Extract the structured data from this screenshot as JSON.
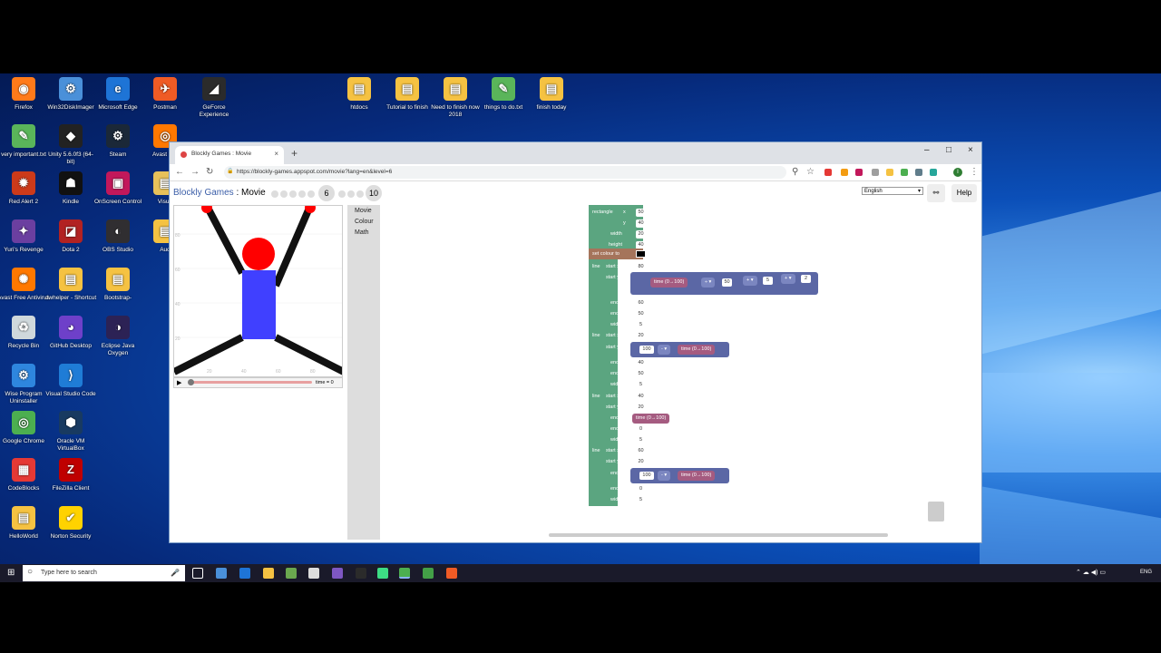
{
  "desktop": {
    "icons": [
      {
        "label": "Firefox",
        "color": "#ff7a1a",
        "glyph": "◉"
      },
      {
        "label": "Win32DiskImager",
        "color": "#4a90d9",
        "glyph": "⚙"
      },
      {
        "label": "Microsoft Edge",
        "color": "#1e74d6",
        "glyph": "e"
      },
      {
        "label": "Postman",
        "color": "#ef5b25",
        "glyph": "✈"
      },
      {
        "label": "GeForce Experience",
        "color": "#2b2b2b",
        "glyph": "◢"
      },
      {
        "label": "very important.txt",
        "color": "#5ab55a",
        "glyph": "✎"
      },
      {
        "label": "Unity 5.6.0f3 (64-bit)",
        "color": "#222222",
        "glyph": "◆"
      },
      {
        "label": "Steam",
        "color": "#1b2838",
        "glyph": "⚙"
      },
      {
        "label": "Avast Bro",
        "color": "#ff7800",
        "glyph": "◎"
      },
      {
        "label": "Red Alert 2",
        "color": "#cc3a1a",
        "glyph": "✹"
      },
      {
        "label": "Kindle",
        "color": "#111111",
        "glyph": "☗"
      },
      {
        "label": "OnScreen Control",
        "color": "#c2185b",
        "glyph": "▣"
      },
      {
        "label": "Visua",
        "color": "#e7c15a",
        "glyph": "▤"
      },
      {
        "label": "Yuri's Revenge",
        "color": "#6b3fa0",
        "glyph": "✦"
      },
      {
        "label": "Dota 2",
        "color": "#b22222",
        "glyph": "◪"
      },
      {
        "label": "OBS Studio",
        "color": "#302e31",
        "glyph": "◐"
      },
      {
        "label": "Aud",
        "color": "#f5c242",
        "glyph": "▤"
      },
      {
        "label": "Avast Free Antivirus",
        "color": "#ff7800",
        "glyph": "✺"
      },
      {
        "label": "dwhelper - Shortcut",
        "color": "#f5c242",
        "glyph": "▤"
      },
      {
        "label": "Bootstrap-",
        "color": "#f5c242",
        "glyph": "▤"
      },
      {
        "label": "Recycle Bin",
        "color": "#cfd8dc",
        "glyph": "♻"
      },
      {
        "label": "GitHub Desktop",
        "color": "#6e40c9",
        "glyph": "◕"
      },
      {
        "label": "Eclipse Java Oxygen",
        "color": "#2c2255",
        "glyph": "◑"
      },
      {
        "label": "Wise Program Uninstaller",
        "color": "#2e86de",
        "glyph": "⚙"
      },
      {
        "label": "Visual Studio Code",
        "color": "#1f7cd6",
        "glyph": "⟩"
      },
      {
        "label": "Google Chrome",
        "color": "#4caf50",
        "glyph": "◎"
      },
      {
        "label": "Oracle VM VirtualBox",
        "color": "#183a61",
        "glyph": "⬢"
      },
      {
        "label": "CodeBlocks",
        "color": "#e53935",
        "glyph": "▦"
      },
      {
        "label": "FileZilla Client",
        "color": "#bf0000",
        "glyph": "Z"
      },
      {
        "label": "HelloWorld",
        "color": "#f5c242",
        "glyph": "▤"
      },
      {
        "label": "Norton Security",
        "color": "#ffd200",
        "glyph": "✔"
      },
      {
        "label": "htdocs",
        "color": "#f5c242",
        "glyph": "▤"
      },
      {
        "label": "Tutorial to finish",
        "color": "#f5c242",
        "glyph": "▤"
      },
      {
        "label": "Need to finish now 2018",
        "color": "#f5c242",
        "glyph": "▤"
      },
      {
        "label": "things to do.txt",
        "color": "#5ab55a",
        "glyph": "✎"
      },
      {
        "label": "finish today",
        "color": "#f5c242",
        "glyph": "▤"
      }
    ]
  },
  "browser": {
    "tab_title": "Blockly Games : Movie",
    "tab_close": "×",
    "new_tab": "+",
    "window_controls": {
      "minimize": "–",
      "maximize": "□",
      "close": "×"
    },
    "url": "https://blockly-games.appspot.com/movie?lang=en&level=6",
    "nav": {
      "back": "←",
      "forward": "→",
      "reload": "↻",
      "lock": "🔒",
      "search": "⚲",
      "star": "☆",
      "menu": "⋮",
      "profile": "I"
    }
  },
  "page": {
    "brand": "Blockly Games",
    "separator": " : ",
    "game": "Movie",
    "current_level": "6",
    "max_level": "10",
    "language": "English",
    "link_icon": "⚯",
    "help": "Help",
    "time_label": "time = 0",
    "play": "▶",
    "y_ticks": [
      "80",
      "60",
      "40",
      "20"
    ],
    "x_ticks": [
      "20",
      "40",
      "60",
      "80"
    ],
    "toolbox": [
      "Movie",
      "Colour",
      "Math"
    ]
  },
  "blocks": {
    "rectangle": {
      "label": "rectangle",
      "x_label": "x",
      "x": "50",
      "y_label": "y",
      "y": "40",
      "w_label": "width",
      "w": "20",
      "h_label": "height",
      "h": "40"
    },
    "set_colour": "set colour to",
    "line1": {
      "label": "line",
      "sx_label": "start x",
      "sx": "80",
      "sy_label": "start y",
      "ex_label": "end x",
      "ex": "60",
      "ey_label": "end y",
      "ey": "50",
      "w_label": "width",
      "w": "5"
    },
    "expr1": {
      "time": "time (0→100)",
      "op1": "÷ ▾",
      "n1": "50",
      "op2": "+ ▾",
      "n2": "5",
      "op3": "+ ▾",
      "n3": "2"
    },
    "line2": {
      "label": "line",
      "sx_label": "start x",
      "sx": "20",
      "sy_label": "start y",
      "ex_label": "end x",
      "ex": "40",
      "ey_label": "end y",
      "ey": "50",
      "w_label": "width",
      "w": "5"
    },
    "expr2": {
      "n": "100",
      "op": "- ▾",
      "time": "time (0→100)"
    },
    "line3": {
      "label": "line",
      "sx_label": "start x",
      "sx": "40",
      "sy_label": "start y",
      "sy": "20",
      "ex_label": "end x",
      "ex_time": "time (0→100)",
      "ey_label": "end y",
      "ey": "0",
      "w_label": "width",
      "w": "5"
    },
    "line4": {
      "label": "line",
      "sx_label": "start x",
      "sx": "60",
      "sy_label": "start y",
      "sy": "20",
      "ex_label": "end x",
      "ey_label": "end y",
      "ey": "0",
      "w_label": "width",
      "w": "5"
    },
    "expr3": {
      "n": "100",
      "op": "- ▾",
      "time": "time (0→100)"
    }
  },
  "taskbar": {
    "search_placeholder": "Type here to search",
    "lang": "ENG"
  },
  "colors": {
    "block_green": "#5ba580",
    "block_math": "#5b67a5",
    "block_time": "#a55b80",
    "block_colour": "#a5745b",
    "figure_red": "#ff0000",
    "figure_blue": "#4040ff"
  }
}
